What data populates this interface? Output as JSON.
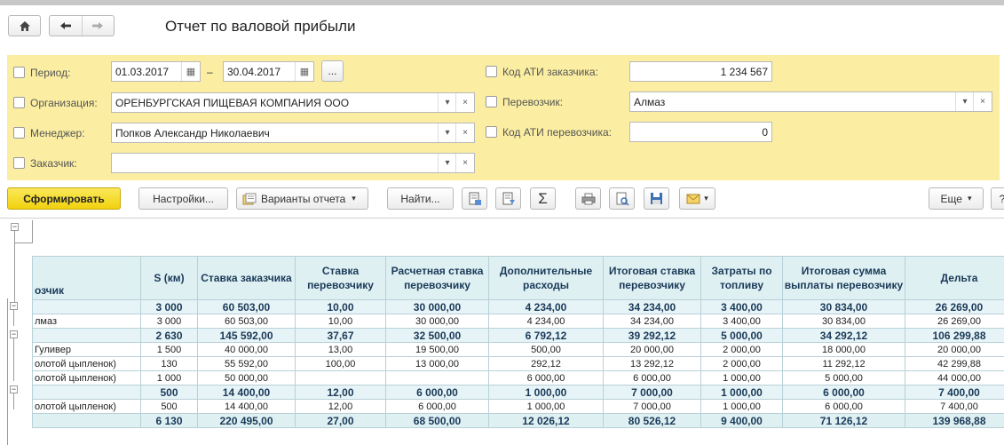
{
  "window": {
    "title": "Отчет по валовой прибыли"
  },
  "nav": {
    "home_icon": "home-icon",
    "back_icon": "arrow-left-icon",
    "forward_icon": "arrow-right-icon"
  },
  "filters": {
    "period": {
      "label": "Период:",
      "from": "01.03.2017",
      "dash": "–",
      "to": "30.04.2017",
      "more": "..."
    },
    "organization": {
      "label": "Организация:",
      "value": "ОРЕНБУРГСКАЯ ПИЩЕВАЯ КОМПАНИЯ ООО"
    },
    "manager": {
      "label": "Менеджер:",
      "value": "Попков Александр Николаевич"
    },
    "customer": {
      "label": "Заказчик:",
      "value": ""
    },
    "customer_ati": {
      "label": "Код АТИ заказчика:",
      "value": "1 234 567"
    },
    "carrier": {
      "label": "Перевозчик:",
      "value": "Алмаз"
    },
    "carrier_ati": {
      "label": "Код АТИ перевозчика:",
      "value": "0"
    }
  },
  "toolbar": {
    "generate": "Сформировать",
    "settings": "Настройки...",
    "variants": "Варианты отчета",
    "find": "Найти...",
    "more": "Еще",
    "help": "?"
  },
  "report": {
    "headers": [
      "озчик",
      "S (км)",
      "Ставка заказчика",
      "Ставка перевозчику",
      "Расчетная ставка перевозчику",
      "Дополнительные расходы",
      "Итоговая ставка перевозчику",
      "Затраты по топливу",
      "Итоговая сумма выплаты перевозчику",
      "Дельта"
    ],
    "rows": [
      {
        "type": "grp",
        "cells": [
          "",
          "3 000",
          "60 503,00",
          "10,00",
          "30 000,00",
          "4 234,00",
          "34 234,00",
          "3 400,00",
          "30 834,00",
          "26 269,00"
        ]
      },
      {
        "type": "det",
        "cells": [
          "лмаз",
          "3 000",
          "60 503,00",
          "10,00",
          "30 000,00",
          "4 234,00",
          "34 234,00",
          "3 400,00",
          "30 834,00",
          "26 269,00"
        ]
      },
      {
        "type": "grp",
        "cells": [
          "",
          "2 630",
          "145 592,00",
          "37,67",
          "32 500,00",
          "6 792,12",
          "39 292,12",
          "5 000,00",
          "34 292,12",
          "106 299,88"
        ]
      },
      {
        "type": "det",
        "cells": [
          "Гуливер",
          "1 500",
          "40 000,00",
          "13,00",
          "19 500,00",
          "500,00",
          "20 000,00",
          "2 000,00",
          "18 000,00",
          "20 000,00"
        ]
      },
      {
        "type": "det",
        "cells": [
          "олотой цыпленок)",
          "130",
          "55 592,00",
          "100,00",
          "13 000,00",
          "292,12",
          "13 292,12",
          "2 000,00",
          "11 292,12",
          "42 299,88"
        ]
      },
      {
        "type": "det",
        "cells": [
          "олотой цыпленок)",
          "1 000",
          "50 000,00",
          "",
          "",
          "6 000,00",
          "6 000,00",
          "1 000,00",
          "5 000,00",
          "44 000,00"
        ]
      },
      {
        "type": "grp",
        "cells": [
          "",
          "500",
          "14 400,00",
          "12,00",
          "6 000,00",
          "1 000,00",
          "7 000,00",
          "1 000,00",
          "6 000,00",
          "7 400,00"
        ]
      },
      {
        "type": "det",
        "cells": [
          "олотой цыпленок)",
          "500",
          "14 400,00",
          "12,00",
          "6 000,00",
          "1 000,00",
          "7 000,00",
          "1 000,00",
          "6 000,00",
          "7 400,00"
        ]
      },
      {
        "type": "tot",
        "cells": [
          "",
          "6 130",
          "220 495,00",
          "27,00",
          "68 500,00",
          "12 026,12",
          "80 526,12",
          "9 400,00",
          "71 126,12",
          "139 968,88"
        ]
      }
    ]
  },
  "colors": {
    "filter_bg": "#fbeea2",
    "generate_bg": "#f1d20e",
    "table_header_bg": "#dff0f3",
    "table_text": "#1a3a58"
  }
}
